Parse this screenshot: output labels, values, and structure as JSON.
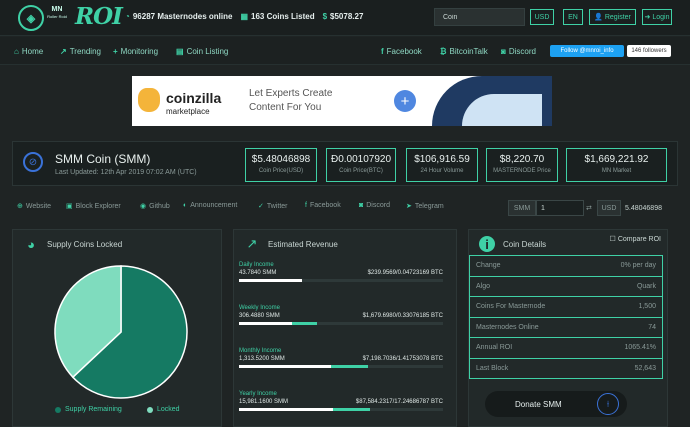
{
  "header": {
    "logo_mn": "MN",
    "logo_sub": "Roller Roid",
    "logo_roi": "ROI",
    "masternodes_online": "96287 Masternodes online",
    "coins_listed": "163 Coins Listed",
    "market_total": "$5078.27",
    "search_value": "Coin",
    "currency": "USD",
    "language": "EN",
    "register_label": "Register",
    "login_label": "Login"
  },
  "nav": {
    "items": [
      "Home",
      "Trending",
      "Monitoring",
      "Coin Listing"
    ],
    "social": [
      "Facebook",
      "BitcoinTalk",
      "Discord"
    ],
    "twitter_follow": "Follow @mnroi_info",
    "twitter_followers": "146 followers"
  },
  "banner": {
    "brand": "coinzilla",
    "brand_sub": "marketplace",
    "line1": "Let Experts Create",
    "line2": "Content For You",
    "plus": "+"
  },
  "coin": {
    "name": "SMM Coin (SMM)",
    "updated": "Last Updated: 12th Apr 2019 07:02 AM (UTC)",
    "metrics": [
      {
        "value": "$5.48046898",
        "label": "Coin Price(USD)"
      },
      {
        "value": "Ð0.00107920",
        "label": "Coin Price(BTC)"
      },
      {
        "value": "$106,916.59",
        "label": "24 Hour Volume"
      },
      {
        "value": "$8,220.70",
        "label": "MASTERNODE Price"
      },
      {
        "value": "$1,669,221.92",
        "label": "MN Market"
      }
    ]
  },
  "links": [
    "Website",
    "Block Explorer",
    "Github",
    "Announcement",
    "Twitter",
    "Facebook",
    "Discord",
    "Telegram"
  ],
  "converter": {
    "from_unit": "SMM",
    "amount": "1",
    "to_unit": "USD",
    "result": "5.48046898"
  },
  "supply_panel": {
    "title": "Supply Coins Locked",
    "legend_remaining": "Supply Remaining",
    "legend_locked": "Locked",
    "remaining_color": "#157a63",
    "locked_color": "#7fdcbe",
    "remaining_fraction": 0.63,
    "locked_fraction": 0.37
  },
  "revenue_panel": {
    "title": "Estimated Revenue",
    "rows": [
      {
        "label": "Daily Income",
        "coins": "43.7840 SMM",
        "value": "$239.9569/0.04723169 BTC",
        "white": 0.31,
        "green": 0
      },
      {
        "label": "Weekly Income",
        "coins": "306.4880 SMM",
        "value": "$1,679.6980/0.33076185 BTC",
        "white": 0.26,
        "green": 0.12
      },
      {
        "label": "Monthly Income",
        "coins": "1,313.5200 SMM",
        "value": "$7,198.7036/1.41753078 BTC",
        "white": 0.45,
        "green": 0.18
      },
      {
        "label": "Yearly Income",
        "coins": "15,981.1600 SMM",
        "value": "$87,584.2317/17.24686787 BTC",
        "white": 0.46,
        "green": 0.18
      }
    ]
  },
  "details_panel": {
    "title": "Coin Details",
    "compare_label": "Compare ROI",
    "rows": [
      {
        "key": "Change",
        "value": "0% per day"
      },
      {
        "key": "Algo",
        "value": "Quark"
      },
      {
        "key": "Coins For Masternode",
        "value": "1,500"
      },
      {
        "key": "Masternodes Online",
        "value": "74"
      },
      {
        "key": "Annual ROI",
        "value": "1065.41%"
      },
      {
        "key": "Last Block",
        "value": "52,643"
      }
    ],
    "donate_label": "Donate SMM"
  }
}
